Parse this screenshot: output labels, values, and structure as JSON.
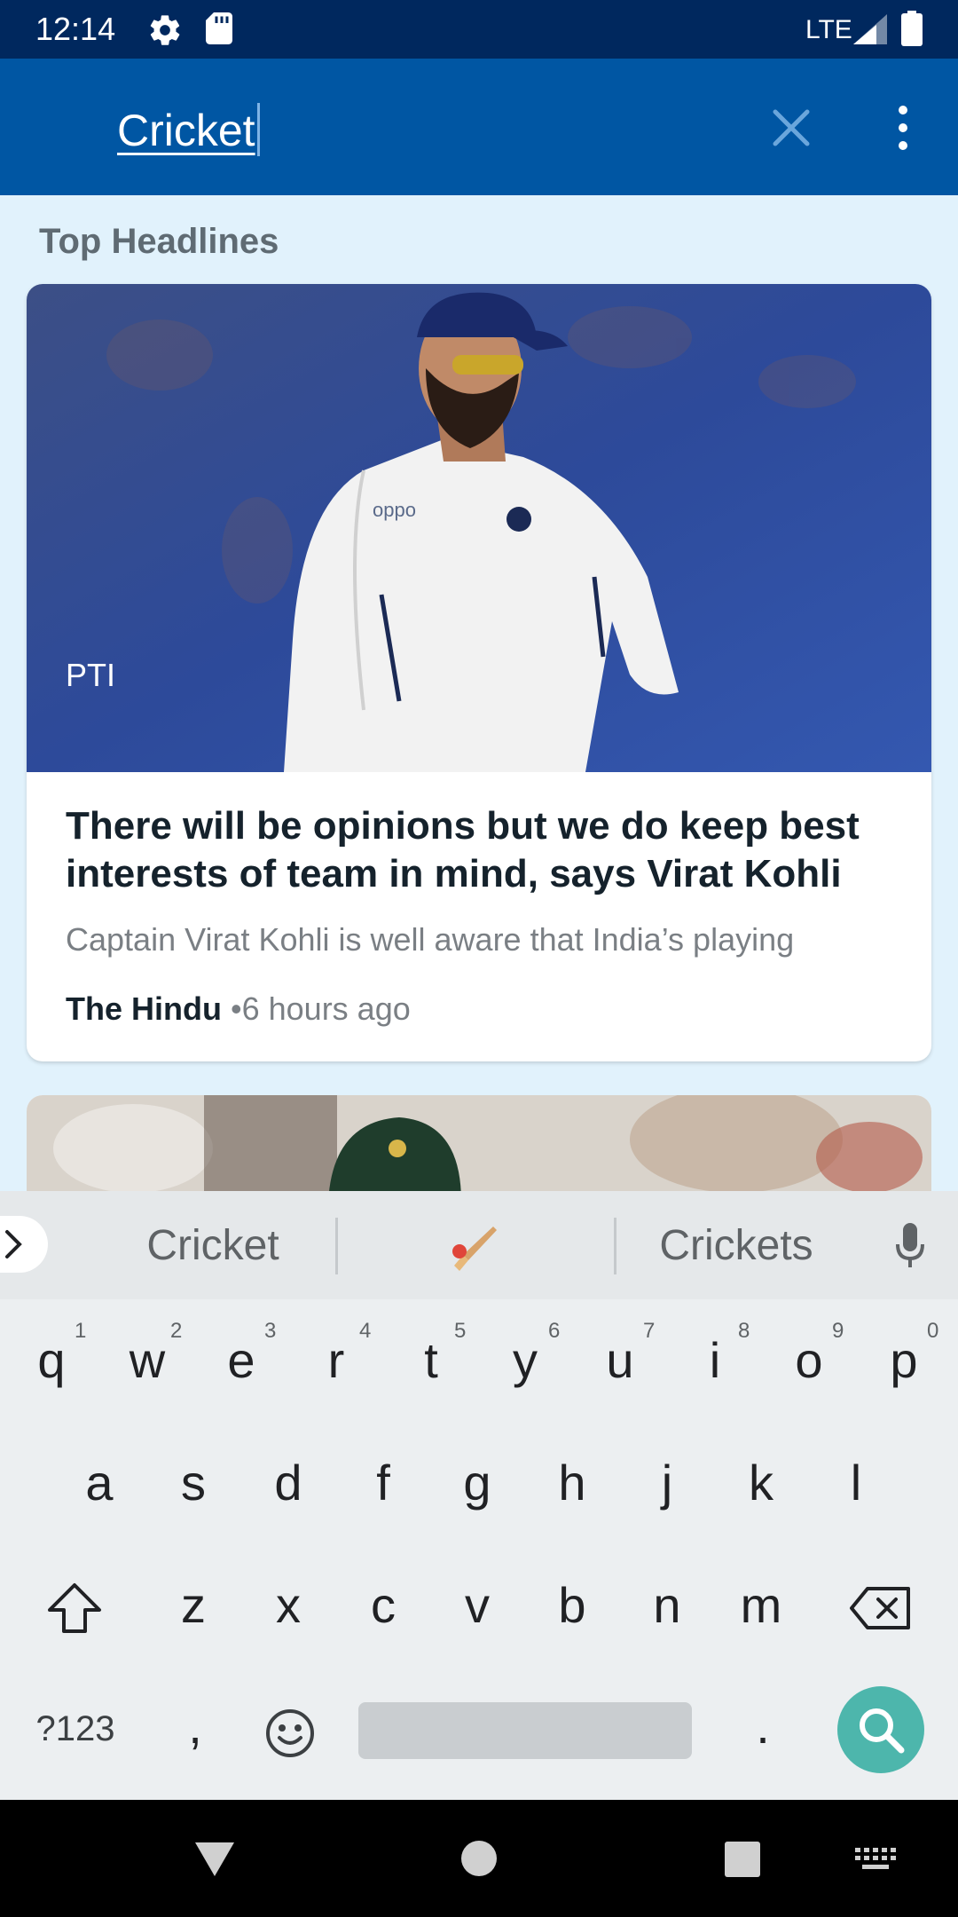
{
  "status_bar": {
    "time": "12:14",
    "network": "LTE"
  },
  "search": {
    "query": "Cricket"
  },
  "section": {
    "title": "Top Headlines"
  },
  "article": {
    "image_credit": "PTI",
    "headline": "There will be opinions but we do keep best interests of team in mind, says Virat Kohli",
    "description": "Captain Virat Kohli is well aware that India’s playing",
    "source": "The Hindu",
    "time": "•6 hours ago"
  },
  "keyboard": {
    "suggestions": [
      "Cricket",
      "Crickets"
    ],
    "suggestion_emoji": "cricket-bat-emoji",
    "row1": [
      "q",
      "w",
      "e",
      "r",
      "t",
      "y",
      "u",
      "i",
      "o",
      "p"
    ],
    "row1_nums": [
      "1",
      "2",
      "3",
      "4",
      "5",
      "6",
      "7",
      "8",
      "9",
      "0"
    ],
    "row2": [
      "a",
      "s",
      "d",
      "f",
      "g",
      "h",
      "j",
      "k",
      "l"
    ],
    "row3": [
      "z",
      "x",
      "c",
      "v",
      "b",
      "n",
      "m"
    ],
    "symbols_label": "?123",
    "comma": ",",
    "period": "."
  },
  "colors": {
    "status_bar": "#00285e",
    "toolbar": "#0056a3",
    "background": "#e1f2fc",
    "search_key": "#4db6ac"
  }
}
